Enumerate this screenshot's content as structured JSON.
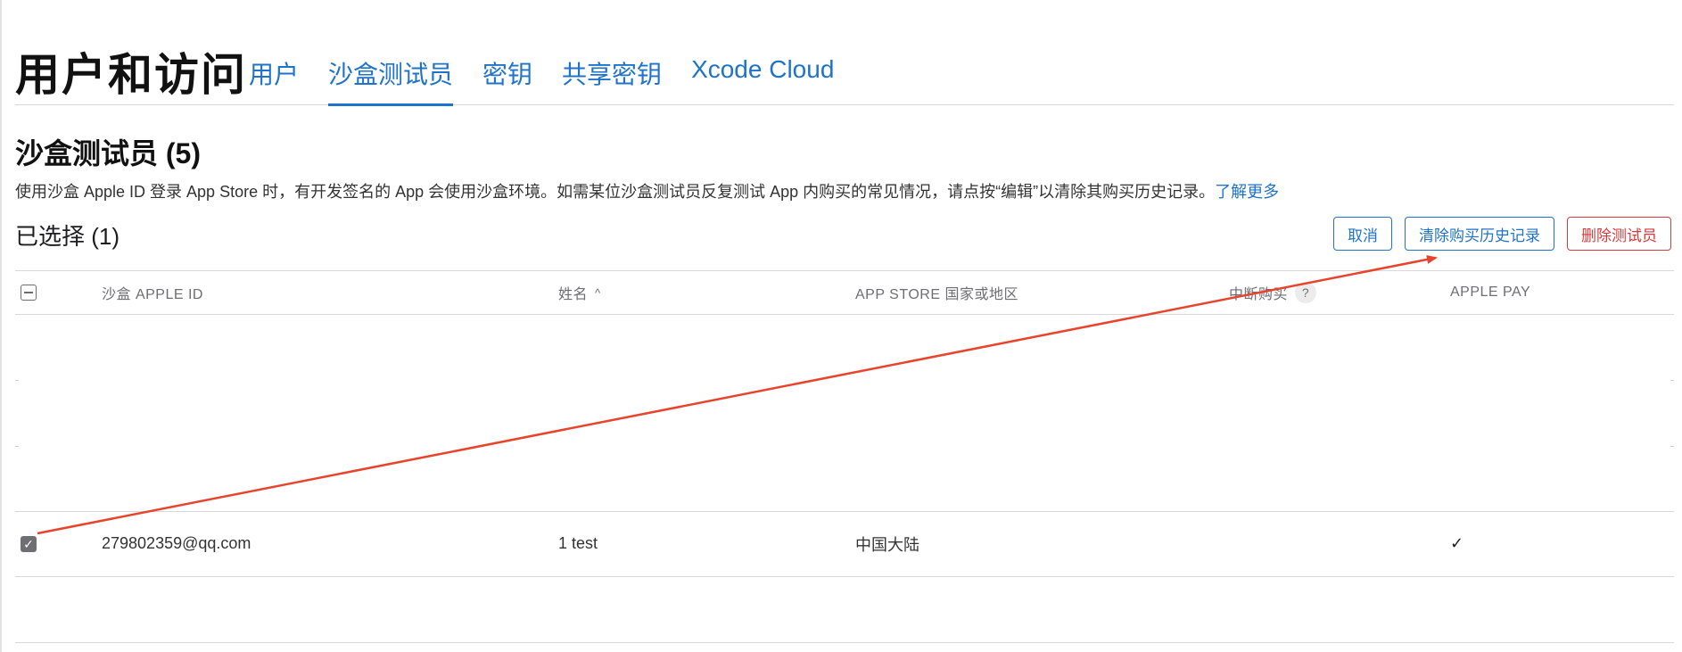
{
  "header": {
    "title": "用户和访问",
    "tabs": [
      {
        "label": "用户",
        "active": false
      },
      {
        "label": "沙盒测试员",
        "active": true
      },
      {
        "label": "密钥",
        "active": false
      },
      {
        "label": "共享密钥",
        "active": false
      },
      {
        "label": "Xcode Cloud",
        "active": false
      }
    ]
  },
  "section": {
    "title": "沙盒测试员 (5)",
    "description": "使用沙盒 Apple ID 登录 App Store 时，有开发签名的 App 会使用沙盒环境。如需某位沙盒测试员反复测试 App 内购买的常见情况，请点按“编辑”以清除其购买历史记录。",
    "learn_more": "了解更多",
    "selected": "已选择 (1)"
  },
  "actions": {
    "cancel": "取消",
    "clear_history": "清除购买历史记录",
    "delete_tester": "删除测试员"
  },
  "table": {
    "columns": {
      "apple_id": "沙盒 APPLE ID",
      "name": "姓名",
      "sort_indicator": "^",
      "region": "APP STORE 国家或地区",
      "interrupted": "中断购买",
      "interrupted_help": "?",
      "apple_pay": "APPLE PAY"
    },
    "rows": [
      {
        "checked": true,
        "apple_id": "279802359@qq.com",
        "name": "1 test",
        "region": "中国大陆",
        "apple_pay": "✓"
      }
    ]
  },
  "colors": {
    "accent": "#1f73c9",
    "danger": "#d93a3a",
    "annotation_arrow": "#e8442c"
  }
}
